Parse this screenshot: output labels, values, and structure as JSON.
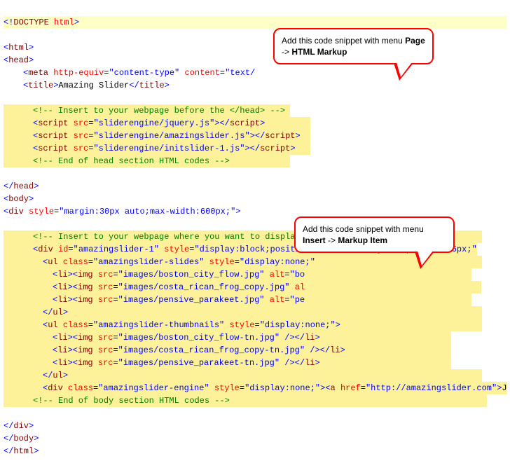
{
  "lines": {
    "l1": "<!DOCTYPE html>",
    "l2": "<html>",
    "l3": "<head>",
    "l4": "  <meta http-equiv=\"content-type\" content=\"text/",
    "l5": "  <title>Amazing Slider</title>",
    "l6": "",
    "l7": "    <!-- Insert to your webpage before the </head> -->",
    "l8": "    <script src=\"sliderengine/jquery.js\"></script>",
    "l9": "    <script src=\"sliderengine/amazingslider.js\"></script>",
    "l10": "    <script src=\"sliderengine/initslider-1.js\"></script>",
    "l11": "    <!-- End of head section HTML codes -->",
    "l12": "",
    "l13": "</head>",
    "l14": "<body>",
    "l15": "<div style=\"margin:30px auto;max-width:600px;\">",
    "l16": "",
    "l17": "    <!-- Insert to your webpage where you want to display the slider -->",
    "l18": "    <div id=\"amazingslider-1\" style=\"display:block;position:relative;margin:16px auto 56px;\"",
    "l19": "        <ul class=\"amazingslider-slides\" style=\"display:none;\"",
    "l20": "            <li><img src=\"images/boston_city_flow.jpg\" alt=\"bo",
    "l21": "            <li><img src=\"images/costa_rican_frog_copy.jpg\" al",
    "l22": "            <li><img src=\"images/pensive_parakeet.jpg\" alt=\"pe",
    "l23": "        </ul>",
    "l24": "        <ul class=\"amazingslider-thumbnails\" style=\"display:none;\">",
    "l25": "            <li><img src=\"images/boston_city_flow-tn.jpg\" /></li>",
    "l26": "            <li><img src=\"images/costa_rican_frog_copy-tn.jpg\" /></li>",
    "l27": "            <li><img src=\"images/pensive_parakeet-tn.jpg\" /></li>",
    "l28": "        </ul>",
    "l29": "        <div class=\"amazingslider-engine\" style=\"display:none;\"><a href=\"http://amazingslider.com\">J",
    "l30": "    <!-- End of body section HTML codes -->",
    "l31": "",
    "l32": "</div>",
    "l33": "</body>",
    "l34": "</html>"
  },
  "callouts": {
    "top_before": "Add this code snippet with menu ",
    "top_menu_a": "Page",
    "top_arrow": " -> ",
    "top_menu_b": "HTML Markup",
    "mid_before": "Add this code snippet with menu ",
    "mid_menu_a": "Insert",
    "mid_arrow": " -> ",
    "mid_menu_b": "Markup Item"
  },
  "title_text": "Amazing Slider"
}
